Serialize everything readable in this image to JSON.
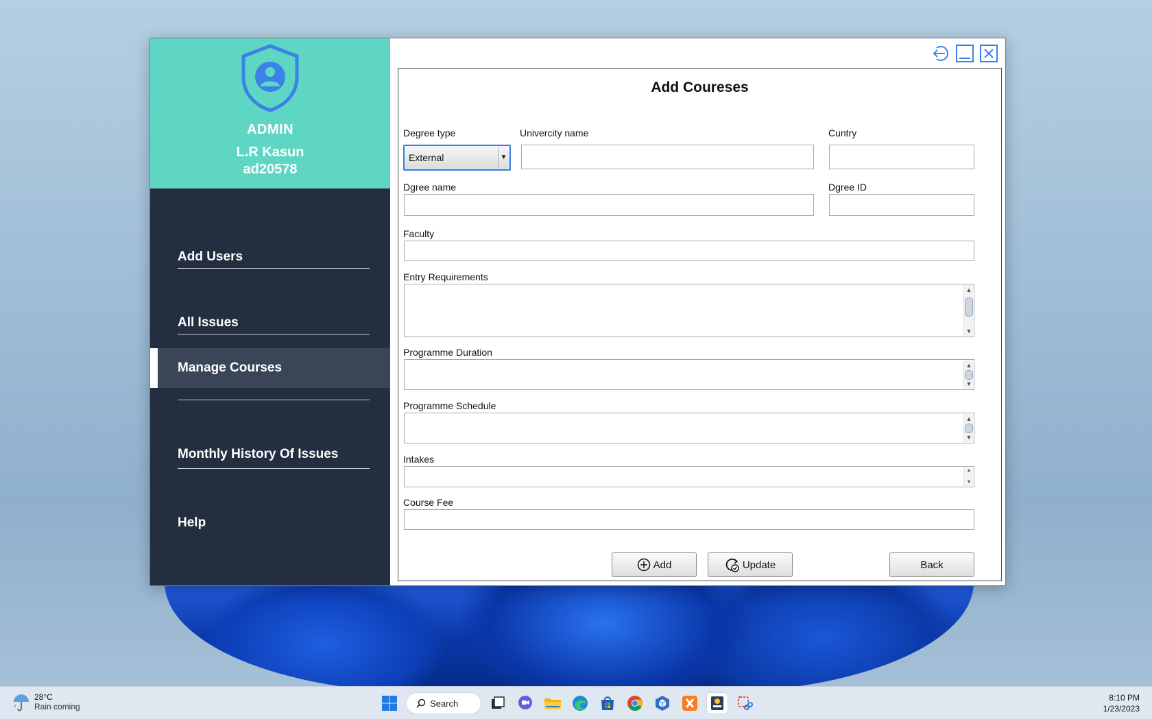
{
  "sidebar": {
    "role": "ADMIN",
    "user_name": "L.R Kasun",
    "user_id": "ad20578",
    "items": [
      {
        "label": "Add Users"
      },
      {
        "label": "All Issues"
      },
      {
        "label": "Manage Courses"
      },
      {
        "label": "Monthly History Of Issues"
      },
      {
        "label": "Help"
      }
    ],
    "active_index": 2
  },
  "form": {
    "title": "Add Coureses",
    "degree_type": {
      "label": "Degree type",
      "value": "External"
    },
    "university_name": {
      "label": "Univercity name",
      "value": ""
    },
    "country": {
      "label": "Cuntry",
      "value": ""
    },
    "degree_name": {
      "label": "Dgree name",
      "value": ""
    },
    "degree_id": {
      "label": "Dgree ID",
      "value": ""
    },
    "faculty": {
      "label": "Faculty",
      "value": ""
    },
    "entry_requirements": {
      "label": "Entry Requirements",
      "value": ""
    },
    "programme_duration": {
      "label": "Programme Duration",
      "value": ""
    },
    "programme_schedule": {
      "label": "Programme Schedule",
      "value": ""
    },
    "intakes": {
      "label": "Intakes",
      "value": ""
    },
    "course_fee": {
      "label": "Course Fee",
      "value": ""
    },
    "buttons": {
      "add": "Add",
      "update": "Update",
      "back": "Back"
    }
  },
  "taskbar": {
    "weather_temp": "28°C",
    "weather_desc": "Rain coming",
    "search_label": "Search",
    "time": "8:10 PM",
    "date": "1/23/2023",
    "apps": [
      "windows-start",
      "task-view",
      "teams-chat",
      "file-explorer",
      "edge",
      "microsoft-store",
      "chrome",
      "virtualbox",
      "xampp",
      "java-app",
      "snipping-tool"
    ]
  },
  "colors": {
    "profile_bg": "#5fd6c4",
    "sidebar_bg": "#232e40",
    "active_item_bg": "#3a4558",
    "accent_blue": "#3c7de0"
  }
}
